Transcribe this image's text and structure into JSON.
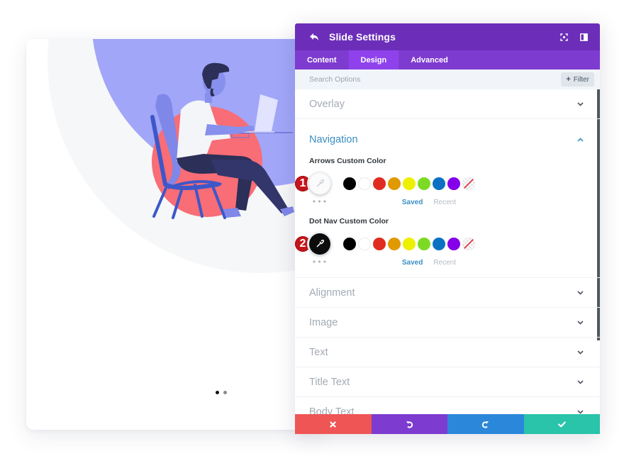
{
  "panel": {
    "title": "Slide Settings",
    "tabs": [
      {
        "label": "Content",
        "active": false
      },
      {
        "label": "Design",
        "active": true
      },
      {
        "label": "Advanced",
        "active": false
      }
    ],
    "search": {
      "placeholder": "Search Options",
      "value": ""
    },
    "filter_label": "Filter",
    "sections": {
      "overlay": "Overlay",
      "navigation": "Navigation",
      "alignment": "Alignment",
      "image": "Image",
      "text": "Text",
      "title_text": "Title Text",
      "body_text": "Body Text"
    },
    "navigation": {
      "arrows": {
        "label": "Arrows Custom Color",
        "badge": "1",
        "current_color": "none",
        "saved_label": "Saved",
        "recent_label": "Recent"
      },
      "dot_nav": {
        "label": "Dot Nav Custom Color",
        "badge": "2",
        "current_color": "#000000",
        "saved_label": "Saved",
        "recent_label": "Recent"
      },
      "swatches": [
        "#000000",
        "#ffffff",
        "#e02b20",
        "#e09900",
        "#edf000",
        "#7cda24",
        "#0c71c3",
        "#8300e9",
        "transparent"
      ]
    },
    "footer": {
      "cancel": "close-icon",
      "undo": "undo-icon",
      "redo": "redo-icon",
      "save": "check-icon"
    }
  },
  "preview": {
    "slides": 2,
    "active_slide": 1
  },
  "colors": {
    "header": "#6c2eb9",
    "tabs": "#7e3bd0",
    "tab_active": "#8f42ec",
    "accent_blue": "#3b8ec2",
    "badge_red": "#c3151b",
    "cancel": "#ef5555",
    "undo": "#7d3bcf",
    "redo": "#2b87da",
    "save": "#29c4a9"
  }
}
